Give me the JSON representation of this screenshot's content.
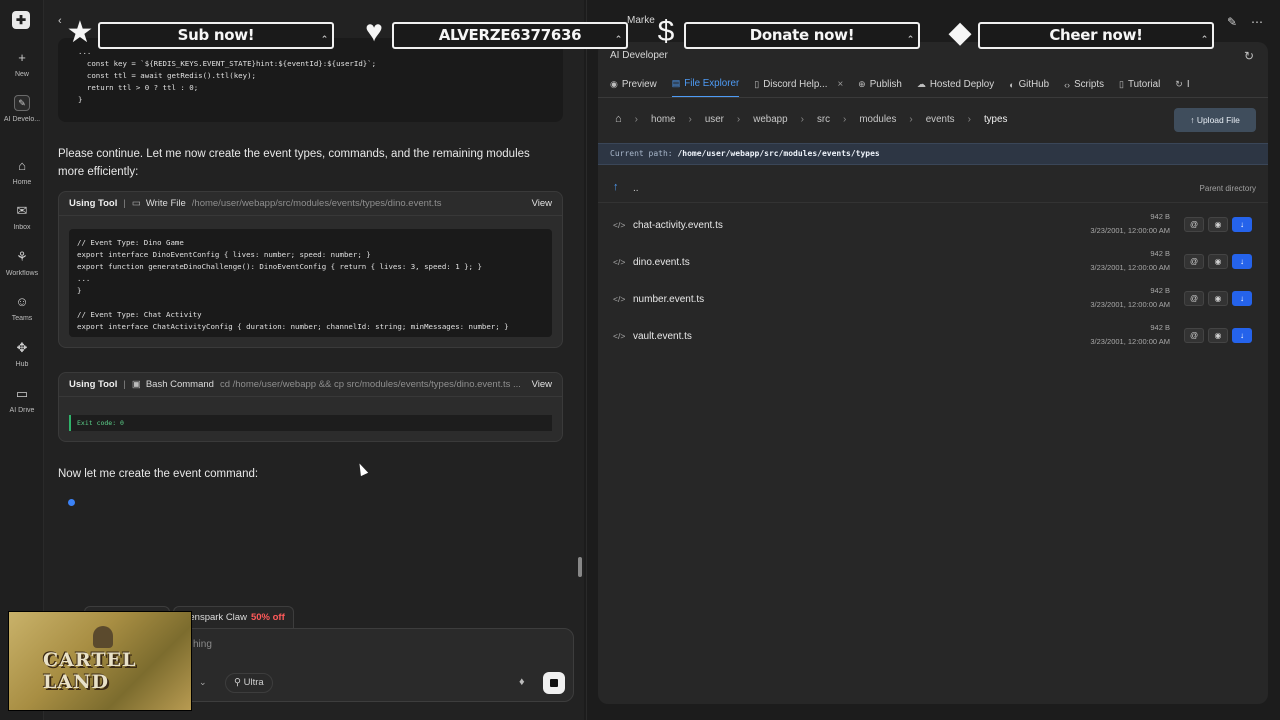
{
  "rail": {
    "items": [
      {
        "icon": "plus-icon",
        "glyph": "+",
        "label": "New"
      },
      {
        "icon": "ai-developer-icon",
        "glyph": "✎",
        "label": "AI Develo..."
      },
      {
        "icon": "home-icon",
        "glyph": "⌂",
        "label": "Home"
      },
      {
        "icon": "inbox-icon",
        "glyph": "✉",
        "label": "Inbox"
      },
      {
        "icon": "workflows-icon",
        "glyph": "⚘",
        "label": "Workflows"
      },
      {
        "icon": "teams-icon",
        "glyph": "☺",
        "label": "Teams"
      },
      {
        "icon": "hub-icon",
        "glyph": "✥",
        "label": "Hub"
      },
      {
        "icon": "drive-icon",
        "glyph": "▭",
        "label": "AI Drive"
      }
    ]
  },
  "banner": {
    "items": [
      {
        "icon": "star-icon",
        "glyph": "★",
        "label": "Sub now!"
      },
      {
        "icon": "heart-icon",
        "glyph": "♥",
        "label": "ALVERZE6377636"
      },
      {
        "icon": "dollar-icon",
        "glyph": "$",
        "label": "Donate now!"
      },
      {
        "icon": "diamond-icon",
        "glyph": "◆",
        "label": "Cheer now!"
      }
    ],
    "partial_title": "Marke"
  },
  "chat": {
    "snippet1": "...\n  const key = `${REDIS_KEYS.EVENT_STATE}hint:${eventId}:${userId}`;\n  const ttl = await getRedis().ttl(key);\n  return ttl > 0 ? ttl : 0;\n}",
    "message1": "Please continue. Let me now create the event types, commands, and the remaining modules more efficiently:",
    "tool1": {
      "label": "Using Tool",
      "op": "Write File",
      "path": "/home/user/webapp/src/modules/events/types/dino.event.ts",
      "view": "View",
      "code": "// Event Type: Dino Game\nexport interface DinoEventConfig { lives: number; speed: number; }\nexport function generateDinoChallenge(): DinoEventConfig { return { lives: 3, speed: 1 }; }\n...\n}\n\n// Event Type: Chat Activity\nexport interface ChatActivityConfig { duration: number; channelId: string; minMessages: number; }"
    },
    "tool2": {
      "label": "Using Tool",
      "op": "Bash Command",
      "path": "cd /home/user/webapp && cp src/modules/events/types/dino.event.ts ...",
      "view": "View",
      "exit": "Exit code: 0"
    },
    "message2": "Now let me create the event command:",
    "promo": {
      "label": "Genspark Claw",
      "off": "50% off"
    },
    "input_placeholder": "hing",
    "mode": "Ultra"
  },
  "webcam": {
    "logo_text": "CARTEL LAND"
  },
  "right": {
    "title": "AI Developer",
    "tabs": [
      {
        "icon": "eye-icon",
        "glyph": "◉",
        "label": "Preview",
        "active": false
      },
      {
        "icon": "file-explorer-icon",
        "glyph": "▤",
        "label": "File Explorer",
        "active": true
      },
      {
        "icon": "document-icon",
        "glyph": "▯",
        "label": "Discord Help...",
        "active": false,
        "closable": true
      },
      {
        "icon": "globe-icon",
        "glyph": "⊕",
        "label": "Publish",
        "active": false
      },
      {
        "icon": "cloud-icon",
        "glyph": "☁",
        "label": "Hosted Deploy",
        "active": false
      },
      {
        "icon": "github-icon",
        "glyph": "◐",
        "label": "GitHub",
        "active": false
      },
      {
        "icon": "code-icon",
        "glyph": "‹›",
        "label": "Scripts",
        "active": false
      },
      {
        "icon": "book-icon",
        "glyph": "▯",
        "label": "Tutorial",
        "active": false
      },
      {
        "icon": "history-icon",
        "glyph": "↻",
        "label": "I",
        "active": false
      }
    ],
    "breadcrumb": [
      "home",
      "user",
      "webapp",
      "src",
      "modules",
      "events",
      "types"
    ],
    "upload_label": "Upload File",
    "current_path_label": "Current path:",
    "current_path": "/home/user/webapp/src/modules/events/types",
    "parent_dots": "..",
    "parent_label": "Parent directory",
    "files": [
      {
        "name": "chat-activity.event.ts",
        "size": "942 B",
        "date": "3/23/2001, 12:00:00 AM"
      },
      {
        "name": "dino.event.ts",
        "size": "942 B",
        "date": "3/23/2001, 12:00:00 AM"
      },
      {
        "name": "number.event.ts",
        "size": "942 B",
        "date": "3/23/2001, 12:00:00 AM"
      },
      {
        "name": "vault.event.ts",
        "size": "942 B",
        "date": "3/23/2001, 12:00:00 AM"
      }
    ]
  }
}
